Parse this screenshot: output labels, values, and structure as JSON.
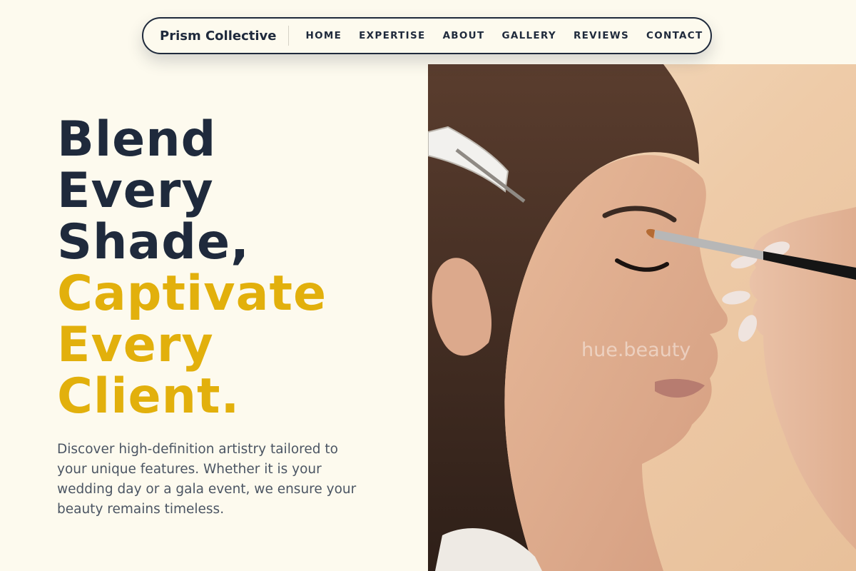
{
  "nav": {
    "brand": "Prism Collective",
    "links": [
      "HOME",
      "EXPERTISE",
      "ABOUT",
      "GALLERY",
      "REVIEWS",
      "CONTACT"
    ]
  },
  "hero": {
    "headline_dark": [
      "Blend",
      "Every",
      "Shade,"
    ],
    "headline_accent": [
      "Captivate",
      "Every",
      "Client."
    ],
    "description": "Discover high-definition artistry tailored to your unique features. Whether it is your wedding day or a gala event, we ensure your beauty remains timeless.",
    "image_watermark": "hue.beauty"
  },
  "colors": {
    "background": "#fdfaee",
    "navy": "#1f2a3c",
    "gold": "#e2b00c",
    "body_text": "#4b5563"
  },
  "icons": {
    "hero_image": "makeup-application-photo"
  }
}
